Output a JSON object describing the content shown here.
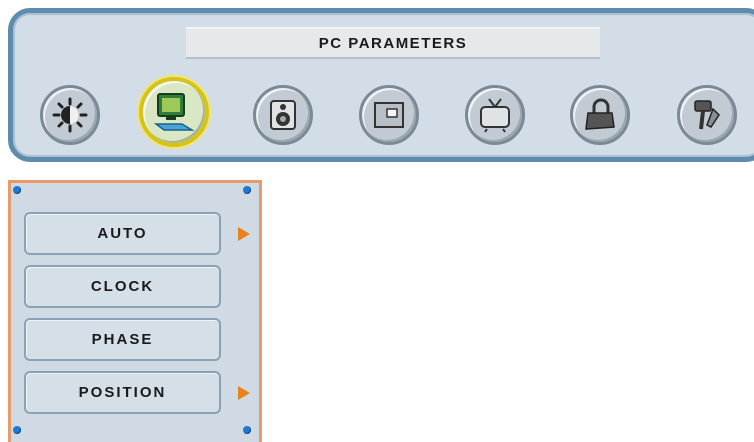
{
  "screen": {
    "title": "PC PARAMETERS"
  },
  "icons": [
    {
      "name": "brightness-icon",
      "selected": false
    },
    {
      "name": "pc-monitor-icon",
      "selected": true
    },
    {
      "name": "speaker-icon",
      "selected": false
    },
    {
      "name": "window-icon",
      "selected": false
    },
    {
      "name": "tv-icon",
      "selected": false
    },
    {
      "name": "lock-icon",
      "selected": false
    },
    {
      "name": "tools-icon",
      "selected": false
    }
  ],
  "menu": {
    "items": [
      {
        "label": "AUTO",
        "has_arrow": true
      },
      {
        "label": "CLOCK",
        "has_arrow": false
      },
      {
        "label": "PHASE",
        "has_arrow": false
      },
      {
        "label": "POSITION",
        "has_arrow": true
      }
    ]
  },
  "colors": {
    "frame_border": "#5f8cad",
    "panel_border": "#e99a6b",
    "selected_ring": "#d6c21e",
    "arrow": "#e8821c",
    "corner_dot": "#1e7bd0"
  }
}
